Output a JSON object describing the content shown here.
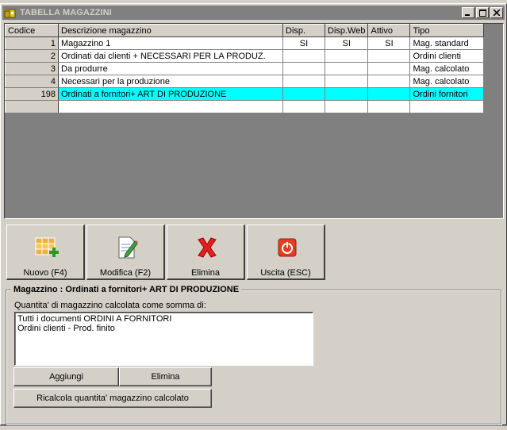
{
  "window": {
    "title": "TABELLA MAGAZZINI",
    "minimize_label": "_",
    "maximize_label": "□",
    "close_label": "✕"
  },
  "grid": {
    "columns": [
      "Codice",
      "Descrizione magazzino",
      "Disp.",
      "Disp.Web",
      "Attivo",
      "Tipo"
    ],
    "rows": [
      {
        "code": "1",
        "desc": "Magazzino 1",
        "disp": "SI",
        "dispweb": "SI",
        "attivo": "SI",
        "tipo": "Mag. standard"
      },
      {
        "code": "2",
        "desc": "Ordinati dai clienti + NECESSARI  PER LA PRODUZ.",
        "disp": "",
        "dispweb": "",
        "attivo": "",
        "tipo": "Ordini clienti"
      },
      {
        "code": "3",
        "desc": "Da produrre",
        "disp": "",
        "dispweb": "",
        "attivo": "",
        "tipo": "Mag. calcolato"
      },
      {
        "code": "4",
        "desc": "Necessari per la produzione",
        "disp": "",
        "dispweb": "",
        "attivo": "",
        "tipo": "Mag. calcolato"
      },
      {
        "code": "198",
        "desc": "Ordinati a fornitori+ ART DI PRODUZIONE",
        "disp": "",
        "dispweb": "",
        "attivo": "",
        "tipo": "Ordini fornitori"
      }
    ],
    "selected_row": 4
  },
  "toolbar": {
    "nuovo": "Nuovo (F4)",
    "modifica": "Modifica (F2)",
    "elimina": "Elimina",
    "uscita": "Uscita (ESC)"
  },
  "detail": {
    "group_title": "Magazzino : Ordinati a fornitori+ ART DI PRODUZIONE",
    "description": "Quantita' di magazzino calcolata come somma di:",
    "list_items": [
      "Tutti i documenti ORDINI A FORNITORI",
      "Ordini clienti - Prod. finito"
    ],
    "aggiungi": "Aggiungi",
    "elimina": "Elimina",
    "ricalcola": "Ricalcola quantita' magazzino calcolato"
  },
  "colors": {
    "selection": "#00ffff",
    "titlebar": "#808080",
    "face": "#d4d0c8"
  }
}
